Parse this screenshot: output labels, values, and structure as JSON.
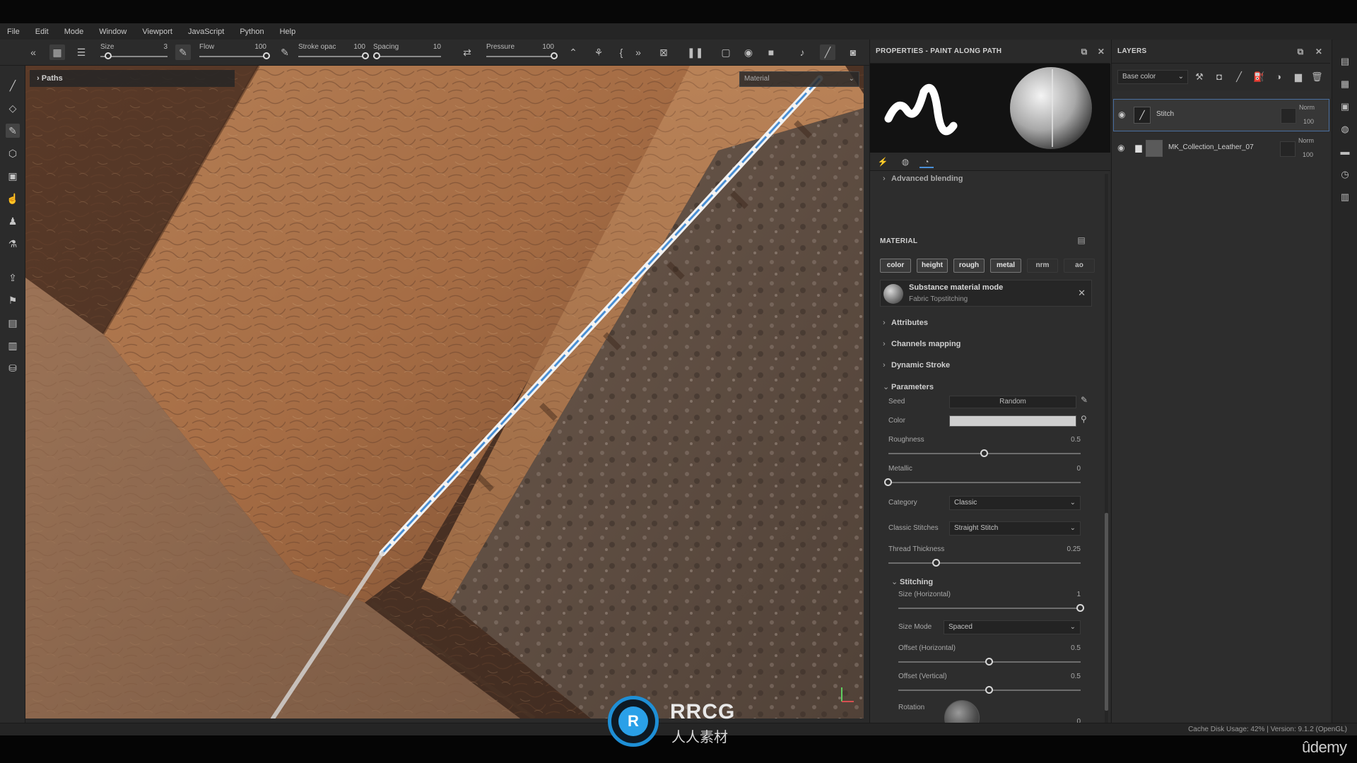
{
  "menu": [
    "File",
    "Edit",
    "Mode",
    "Window",
    "Viewport",
    "JavaScript",
    "Python",
    "Help"
  ],
  "toolbar": {
    "size_label": "Size",
    "size_value": "3",
    "size_level": 0.12,
    "flow_label": "Flow",
    "flow_value": "100",
    "flow_level": 1.0,
    "stroke_label": "Stroke opac",
    "stroke_value": "100",
    "stroke_level": 1.0,
    "spacing_label": "Spacing",
    "spacing_value": "10",
    "spacing_level": 0.05,
    "pressure_label": "Pressure",
    "pressure_value": "100",
    "pressure_level": 1.0
  },
  "viewport": {
    "paths_label": "Paths",
    "material_select": "Material"
  },
  "properties": {
    "title": "PROPERTIES - PAINT ALONG PATH",
    "advanced_blending": "Advanced blending",
    "material_title": "MATERIAL",
    "channels": [
      {
        "label": "color",
        "on": true
      },
      {
        "label": "height",
        "on": true
      },
      {
        "label": "rough",
        "on": true
      },
      {
        "label": "metal",
        "on": true
      },
      {
        "label": "nrm",
        "on": false
      },
      {
        "label": "ao",
        "on": false
      }
    ],
    "material_mode": "Substance material mode",
    "material_name": "Fabric Topstitching",
    "sections": [
      "Attributes",
      "Channels mapping",
      "Dynamic Stroke",
      "Parameters"
    ],
    "params": {
      "seed_label": "Seed",
      "seed_value": "Random",
      "color_label": "Color",
      "color_value": "#cfcfcf",
      "roughness_label": "Roughness",
      "roughness_value": "0.5",
      "roughness_level": 0.5,
      "metallic_label": "Metallic",
      "metallic_value": "0",
      "metallic_level": 0.0,
      "category_label": "Category",
      "category_value": "Classic",
      "classic_label": "Classic Stitches",
      "classic_value": "Straight Stitch",
      "thread_label": "Thread Thickness",
      "thread_value": "0.25",
      "thread_level": 0.25,
      "stitching_title": "Stitching",
      "size_h_label": "Size (Horizontal)",
      "size_h_value": "1",
      "size_h_level": 1.0,
      "size_mode_label": "Size Mode",
      "size_mode_value": "Spaced",
      "offset_h_label": "Offset (Horizontal)",
      "offset_h_value": "0.5",
      "offset_h_level": 0.5,
      "offset_v_label": "Offset (Vertical)",
      "offset_v_value": "0.5",
      "offset_v_level": 0.5,
      "rotation_label": "Rotation",
      "rotation_value": "0",
      "rotation_level": 0.0
    }
  },
  "layers": {
    "title": "LAYERS",
    "channel_select": "Base color",
    "items": [
      {
        "name": "Stitch",
        "blend": "Norm",
        "opacity": "100",
        "selected": true
      },
      {
        "name": "MK_Collection_Leather_07",
        "blend": "Norm",
        "opacity": "100",
        "selected": false
      }
    ]
  },
  "status": {
    "text": "Cache Disk Usage:    42% | Version: 9.1.2 (OpenGL)"
  },
  "watermark": {
    "brand": "RRCG",
    "subtitle": "人人素材",
    "logo_letter": "R"
  },
  "udemy": "ûdemy"
}
